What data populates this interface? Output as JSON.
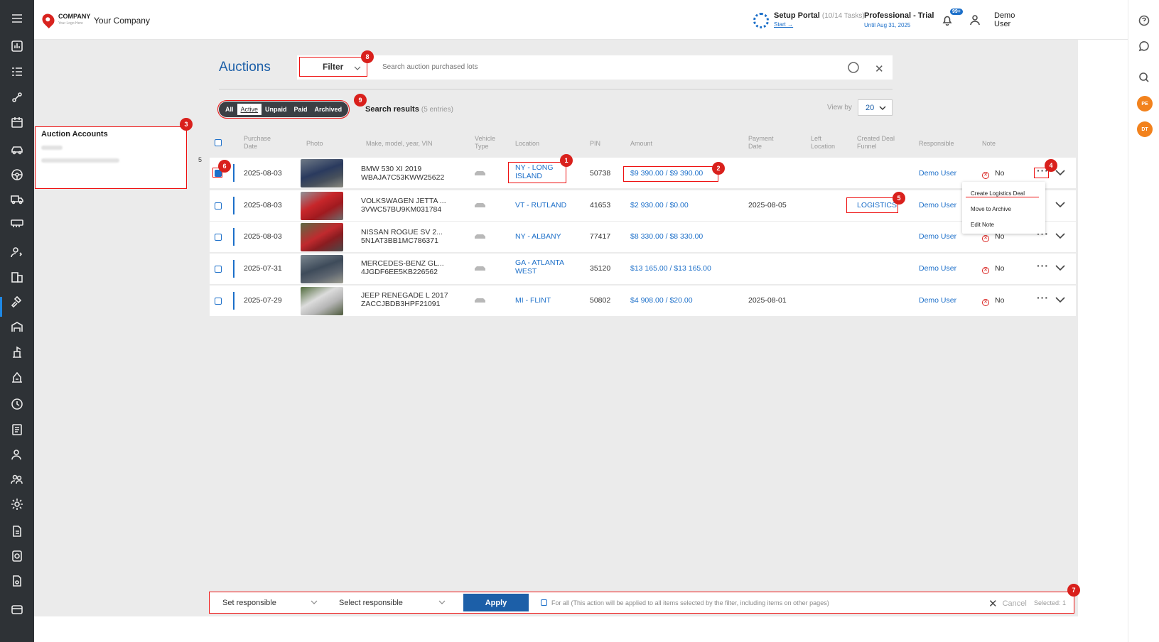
{
  "header": {
    "company_logo_text": "COMPANY",
    "company_logo_sub": "Your Logo Here",
    "company_name": "Your Company",
    "setup_title": "Setup Portal",
    "setup_tasks": "(10/14 Tasks)",
    "setup_link": "Start →",
    "plan_title": "Professional - Trial",
    "plan_until": "Until Aug 31, 2025",
    "notifications_badge": "99+",
    "user_name": "Demo User"
  },
  "right_rail": {
    "avatar1": "PE",
    "avatar2": "DT"
  },
  "sidebar_panel": {
    "title": "Auction Accounts",
    "count": "5"
  },
  "page": {
    "title": "Auctions",
    "filter_label": "Filter",
    "search_placeholder": "Search auction purchased lots",
    "tabs": [
      "All",
      "Active",
      "Unpaid",
      "Paid",
      "Archived"
    ],
    "results_label": "Search results",
    "results_count": "(5 entries)",
    "view_by_label": "View by",
    "view_by_value": "20"
  },
  "table": {
    "headers": {
      "purchase_date": "Purchase Date",
      "photo": "Photo",
      "make": "Make, model, year, VIN",
      "vehicle_type": "Vehicle Type",
      "location": "Location",
      "pin": "PIN",
      "amount": "Amount",
      "payment_date": "Payment Date",
      "left_location": "Left Location",
      "created_deal": "Created Deal Funnel",
      "responsible": "Responsible",
      "note": "Note"
    },
    "rows": [
      {
        "date": "2025-08-03",
        "model": "BMW 530 XI 2019",
        "vin": "WBAJA7C53KWW25622",
        "loc1": "NY - LONG",
        "loc2": "ISLAND",
        "pin": "50738",
        "amount": "$9 390.00 / $9 390.00",
        "payment_date": "",
        "deal": "",
        "responsible": "Demo User",
        "note": "No",
        "checked": true
      },
      {
        "date": "2025-08-03",
        "model": "VOLKSWAGEN JETTA ...",
        "vin": "3VWC57BU9KM031784",
        "loc1": "VT - RUTLAND",
        "loc2": "",
        "pin": "41653",
        "amount": "$2 930.00 / $0.00",
        "payment_date": "2025-08-05",
        "deal": "LOGISTICS",
        "responsible": "Demo User",
        "note": "",
        "checked": false
      },
      {
        "date": "2025-08-03",
        "model": "NISSAN ROGUE SV 2...",
        "vin": "5N1AT3BB1MC786371",
        "loc1": "NY - ALBANY",
        "loc2": "",
        "pin": "77417",
        "amount": "$8 330.00 / $8 330.00",
        "payment_date": "",
        "deal": "",
        "responsible": "Demo User",
        "note": "No",
        "checked": false
      },
      {
        "date": "2025-07-31",
        "model": "MERCEDES-BENZ GL...",
        "vin": "4JGDF6EE5KB226562",
        "loc1": "GA - ATLANTA",
        "loc2": "WEST",
        "pin": "35120",
        "amount": "$13 165.00 / $13 165.00",
        "payment_date": "",
        "deal": "",
        "responsible": "Demo User",
        "note": "No",
        "checked": false
      },
      {
        "date": "2025-07-29",
        "model": "JEEP RENEGADE L 2017",
        "vin": "ZACCJBDB3HPF21091",
        "loc1": "MI - FLINT",
        "loc2": "",
        "pin": "50802",
        "amount": "$4 908.00 / $20.00",
        "payment_date": "2025-08-01",
        "deal": "",
        "responsible": "Demo User",
        "note": "No",
        "checked": false
      }
    ]
  },
  "context_menu": {
    "items": [
      "Create Logistics Deal",
      "Move to Archive",
      "Edit Note"
    ]
  },
  "bottom_bar": {
    "set_responsible": "Set responsible",
    "select_responsible": "Select responsible",
    "apply": "Apply",
    "for_all_text": "For all (This action will be applied to all items selected by the filter, including items on other pages)",
    "cancel": "Cancel",
    "selected": "Selected: 1"
  },
  "markers": [
    "1",
    "2",
    "3",
    "4",
    "5",
    "6",
    "7",
    "8",
    "9"
  ],
  "colors": {
    "accent": "#1c6fc9",
    "title": "#1c5fa8",
    "marker": "#d9201c",
    "rail": "#2e3236"
  }
}
